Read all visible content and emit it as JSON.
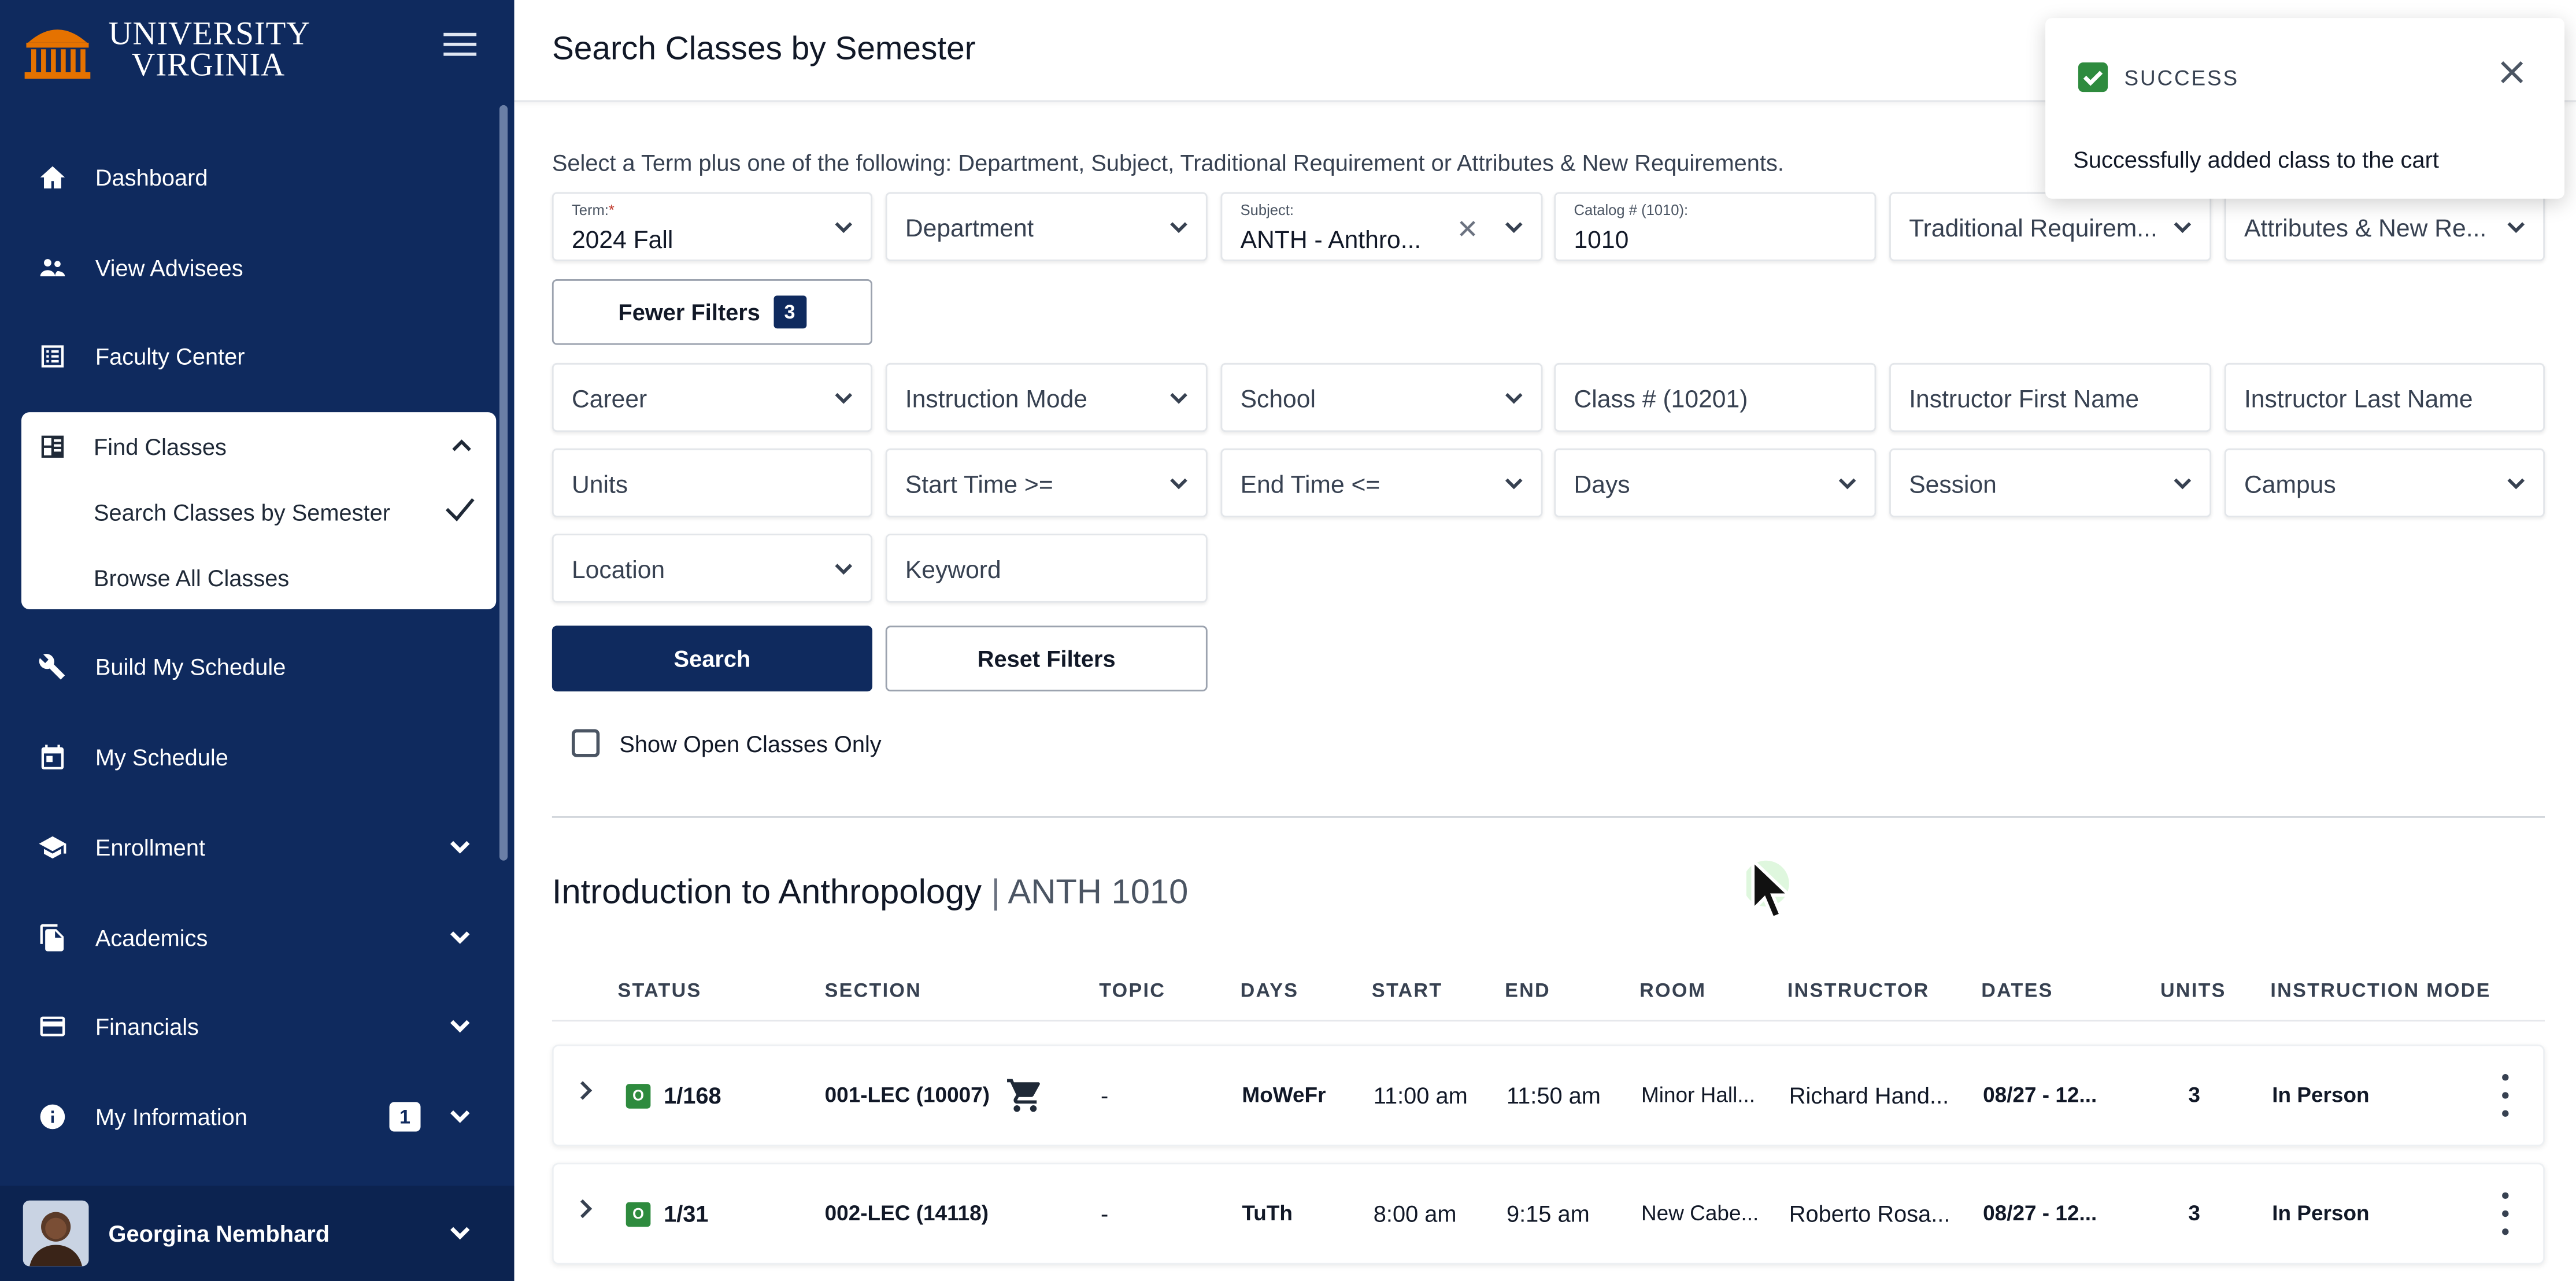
{
  "sidebar": {
    "logo": {
      "line1": "UNIVERSITY",
      "line2": "VIRGINIA"
    },
    "items": [
      {
        "label": "Dashboard"
      },
      {
        "label": "View Advisees"
      },
      {
        "label": "Faculty Center"
      },
      {
        "label": "Find Classes"
      },
      {
        "label": "Build My Schedule"
      },
      {
        "label": "My Schedule"
      },
      {
        "label": "Enrollment"
      },
      {
        "label": "Academics"
      },
      {
        "label": "Financials"
      },
      {
        "label": "My Information",
        "badge": "1"
      }
    ],
    "find_classes_sub": [
      {
        "label": "Search Classes by Semester"
      },
      {
        "label": "Browse All Classes"
      }
    ],
    "user": {
      "name": "Georgina Nembhard"
    }
  },
  "header": {
    "title": "Search Classes by Semester"
  },
  "instructions": "Select a Term plus one of the following: Department, Subject, Traditional Requirement or Attributes & New Requirements.",
  "filters": {
    "term": {
      "label": "Term:",
      "required_mark": "*",
      "value": "2024 Fall"
    },
    "department": "Department",
    "subject": {
      "label": "Subject:",
      "value": "ANTH - Anthro..."
    },
    "catalog": {
      "label": "Catalog # (1010):",
      "value": "1010"
    },
    "traditional": "Traditional Requirem...",
    "attributes": "Attributes & New Re...",
    "fewer_filters": "Fewer Filters",
    "fewer_count": "3",
    "career": "Career",
    "instruction_mode": "Instruction Mode",
    "school": "School",
    "class_num": "Class # (10201)",
    "instructor_first": "Instructor First Name",
    "instructor_last": "Instructor Last Name",
    "units": "Units",
    "start_time": "Start Time >=",
    "end_time": "End Time <=",
    "days": "Days",
    "session": "Session",
    "campus": "Campus",
    "location": "Location",
    "keyword": "Keyword",
    "search": "Search",
    "reset": "Reset Filters",
    "open_only": "Show Open Classes Only"
  },
  "results": {
    "course_name": "Introduction to Anthropology",
    "separator": "|",
    "course_code": "ANTH 1010",
    "columns": [
      "STATUS",
      "SECTION",
      "TOPIC",
      "DAYS",
      "START",
      "END",
      "ROOM",
      "INSTRUCTOR",
      "DATES",
      "UNITS",
      "INSTRUCTION MODE"
    ],
    "rows": [
      {
        "status_icon": "O",
        "status": "1/168",
        "section": "001-LEC (10007)",
        "topic": "-",
        "days": "MoWeFr",
        "start": "11:00 am",
        "end": "11:50 am",
        "room": "Minor Hall...",
        "instructor": "Richard Hand...",
        "dates": "08/27 - 12...",
        "units": "3",
        "mode": "In Person"
      },
      {
        "status_icon": "O",
        "status": "1/31",
        "section": "002-LEC (14118)",
        "topic": "-",
        "days": "TuTh",
        "start": "8:00 am",
        "end": "9:15 am",
        "room": "New Cabe...",
        "instructor": "Roberto Rosa...",
        "dates": "08/27 - 12...",
        "units": "3",
        "mode": "In Person"
      }
    ]
  },
  "toast": {
    "title": "SUCCESS",
    "message": "Successfully added class to the cart"
  },
  "colors": {
    "navy": "#0f2a5e",
    "success": "#2e8b3e",
    "orange": "#e57200"
  }
}
